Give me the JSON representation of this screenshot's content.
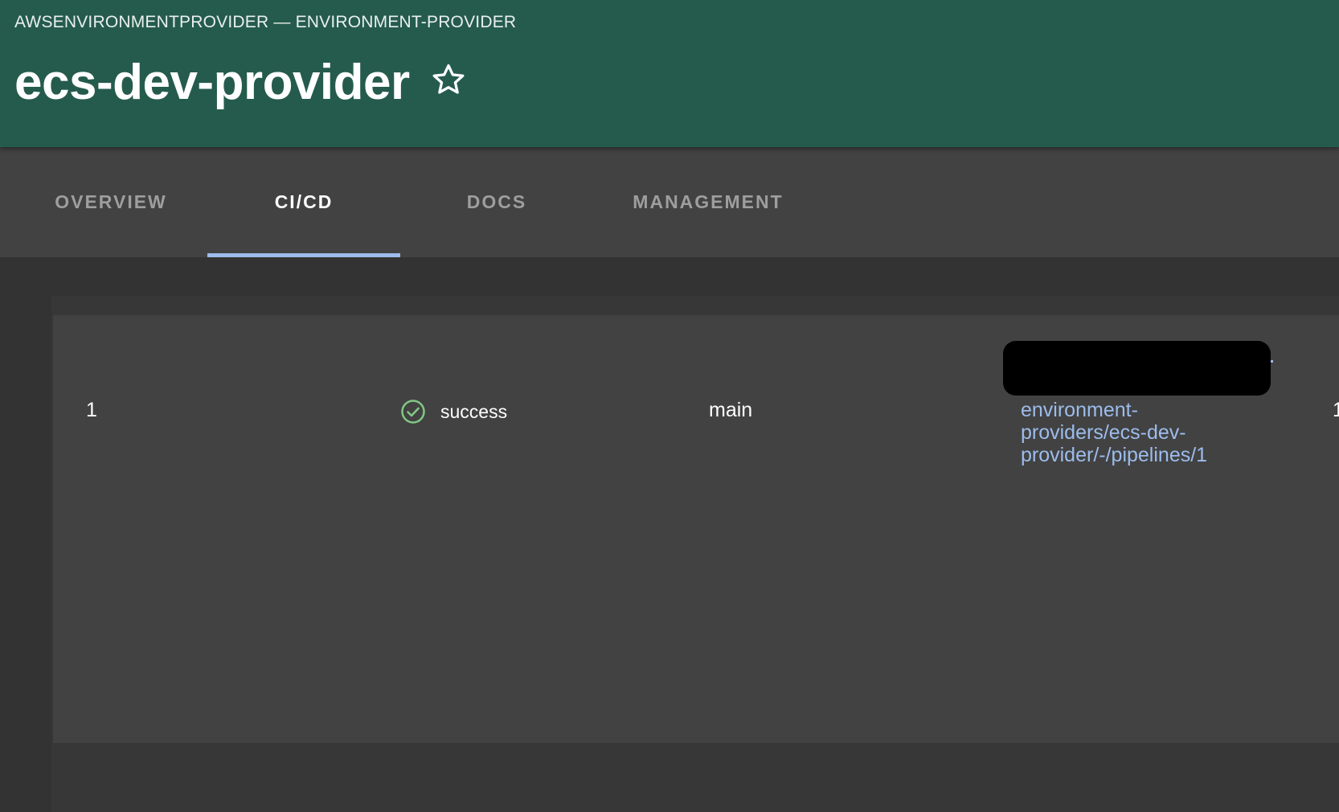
{
  "header": {
    "kind_label": "AWSENVIRONMENTPROVIDER — ENVIRONMENT-PROVIDER",
    "title": "ecs-dev-provider",
    "favorite_icon": "star-outline-icon"
  },
  "tabs": [
    {
      "label": "OVERVIEW",
      "active": false
    },
    {
      "label": "CI/CD",
      "active": true
    },
    {
      "label": "DOCS",
      "active": false
    },
    {
      "label": "MANAGEMENT",
      "active": false
    }
  ],
  "pipeline_table": {
    "rows": [
      {
        "id": "1",
        "status": "success",
        "status_icon": "check-circle-icon",
        "status_color": "#81c784",
        "branch": "main",
        "web_url_visible": "environment-\nproviders/ecs-dev-\nprovider/-/pipelines/1",
        "next_column_peek": "1"
      }
    ]
  },
  "colors": {
    "header_bg": "#255b4d",
    "tab_bar_bg": "#424242",
    "tab_indicator": "#9cbcec",
    "link": "#9cbcec",
    "page_bg": "#333333"
  }
}
